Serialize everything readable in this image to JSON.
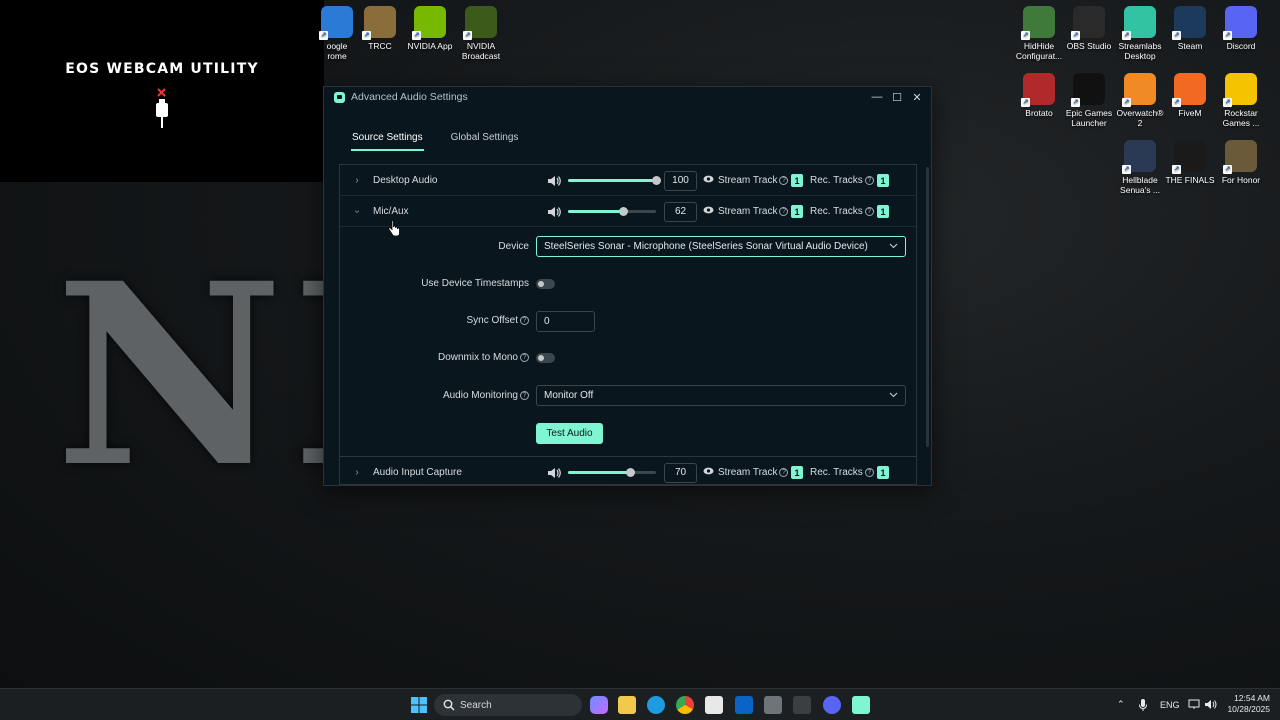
{
  "desktop": {
    "eos_title": "EOS WEBCAM UTILITY",
    "background_text": "NE",
    "icons_top": [
      {
        "label": "oogle\nrome",
        "color": "#2b7bd6"
      },
      {
        "label": "TRCC",
        "color": "#8a6d3b"
      },
      {
        "label": "NVIDIA App",
        "color": "#76b900"
      },
      {
        "label": "NVIDIA\nBroadcast",
        "color": "#3c5a1a"
      }
    ],
    "icons_right": [
      {
        "label": "HidHide\nConfigurat...",
        "color": "#3f7a3a"
      },
      {
        "label": "OBS Studio",
        "color": "#2a2a2a"
      },
      {
        "label": "Streamlabs\nDesktop",
        "color": "#31c3a2"
      },
      {
        "label": "Steam",
        "color": "#1b3a5c"
      },
      {
        "label": "Discord",
        "color": "#5865f2"
      },
      {
        "label": "Brotato",
        "color": "#b02a2a"
      },
      {
        "label": "Epic Games\nLauncher",
        "color": "#111111"
      },
      {
        "label": "Overwatch®\n2",
        "color": "#f08a24"
      },
      {
        "label": "FiveM",
        "color": "#f26a21"
      },
      {
        "label": "Rockstar\nGames ...",
        "color": "#f4c400"
      },
      {
        "label": "Hellblade\nSenua's ...",
        "color": "#2a3a55"
      },
      {
        "label": "THE FINALS",
        "color": "#1a1a1a"
      },
      {
        "label": "For Honor",
        "color": "#6b5a3a"
      }
    ]
  },
  "window": {
    "title": "Advanced Audio Settings",
    "controls": {
      "minimize": "—",
      "maximize": "☐",
      "close": "✕"
    },
    "tabs": [
      {
        "label": "Source Settings",
        "active": true
      },
      {
        "label": "Global Settings",
        "active": false
      }
    ],
    "labels": {
      "stream_track": "Stream Track",
      "rec_tracks": "Rec. Tracks",
      "help": "?"
    },
    "sources": [
      {
        "name": "Desktop Audio",
        "volume": "100",
        "volume_level": 1.0,
        "stream_track": "1",
        "rec_tracks": "1",
        "expanded": false
      },
      {
        "name": "Mic/Aux",
        "volume": "62",
        "volume_level": 0.62,
        "stream_track": "1",
        "rec_tracks": "1",
        "expanded": true
      },
      {
        "name": "Audio Input Capture",
        "volume": "70",
        "volume_level": 0.7,
        "stream_track": "1",
        "rec_tracks": "1",
        "expanded": false
      }
    ],
    "mic_props": {
      "device_label": "Device",
      "device_value": "SteelSeries Sonar - Microphone (SteelSeries Sonar Virtual Audio Device)",
      "timestamps_label": "Use Device Timestamps",
      "sync_offset_label": "Sync Offset",
      "sync_offset_value": "0",
      "downmix_label": "Downmix to Mono",
      "monitoring_label": "Audio Monitoring",
      "monitoring_value": "Monitor Off",
      "test_button": "Test Audio"
    }
  },
  "taskbar": {
    "search_placeholder": "Search",
    "language": "ENG",
    "time": "12:54 AM",
    "date": "10/28/2025"
  }
}
